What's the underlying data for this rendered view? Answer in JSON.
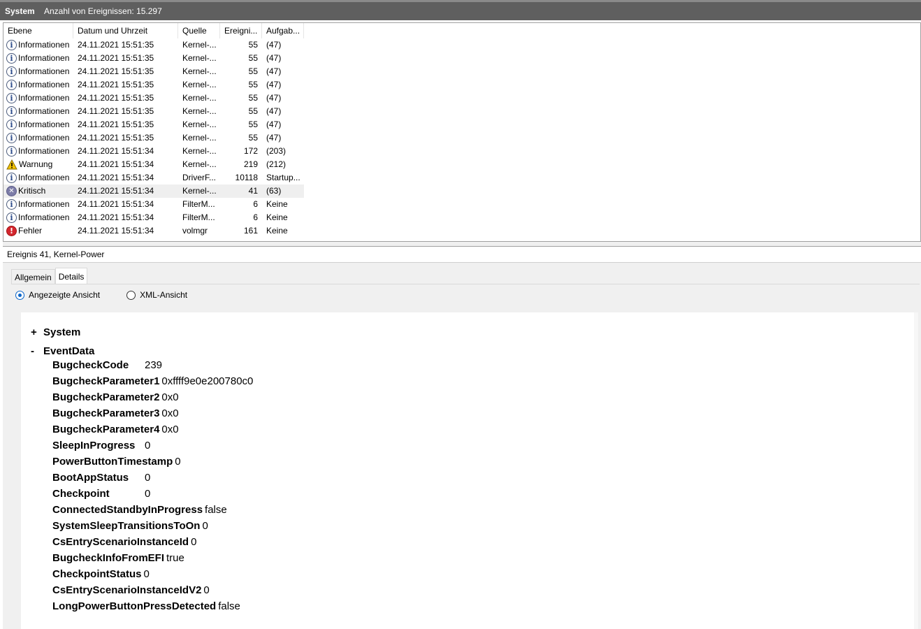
{
  "header": {
    "title": "System",
    "count": "Anzahl von Ereignissen: 15.297"
  },
  "columns": [
    "Ebene",
    "Datum und Uhrzeit",
    "Quelle",
    "Ereigni...",
    "Aufgab..."
  ],
  "rows": [
    {
      "level": "Informationen",
      "icon": "info-icon",
      "date": "24.11.2021 15:51:35",
      "source": "Kernel-...",
      "id": "55",
      "task": "(47)"
    },
    {
      "level": "Informationen",
      "icon": "info-icon",
      "date": "24.11.2021 15:51:35",
      "source": "Kernel-...",
      "id": "55",
      "task": "(47)"
    },
    {
      "level": "Informationen",
      "icon": "info-icon",
      "date": "24.11.2021 15:51:35",
      "source": "Kernel-...",
      "id": "55",
      "task": "(47)"
    },
    {
      "level": "Informationen",
      "icon": "info-icon",
      "date": "24.11.2021 15:51:35",
      "source": "Kernel-...",
      "id": "55",
      "task": "(47)"
    },
    {
      "level": "Informationen",
      "icon": "info-icon",
      "date": "24.11.2021 15:51:35",
      "source": "Kernel-...",
      "id": "55",
      "task": "(47)"
    },
    {
      "level": "Informationen",
      "icon": "info-icon",
      "date": "24.11.2021 15:51:35",
      "source": "Kernel-...",
      "id": "55",
      "task": "(47)"
    },
    {
      "level": "Informationen",
      "icon": "info-icon",
      "date": "24.11.2021 15:51:35",
      "source": "Kernel-...",
      "id": "55",
      "task": "(47)"
    },
    {
      "level": "Informationen",
      "icon": "info-icon",
      "date": "24.11.2021 15:51:35",
      "source": "Kernel-...",
      "id": "55",
      "task": "(47)"
    },
    {
      "level": "Informationen",
      "icon": "info-icon",
      "date": "24.11.2021 15:51:34",
      "source": "Kernel-...",
      "id": "172",
      "task": "(203)"
    },
    {
      "level": "Warnung",
      "icon": "warning-icon",
      "date": "24.11.2021 15:51:34",
      "source": "Kernel-...",
      "id": "219",
      "task": "(212)"
    },
    {
      "level": "Informationen",
      "icon": "info-icon",
      "date": "24.11.2021 15:51:34",
      "source": "DriverF...",
      "id": "10118",
      "task": "Startup..."
    },
    {
      "level": "Kritisch",
      "icon": "critical-icon",
      "date": "24.11.2021 15:51:34",
      "source": "Kernel-...",
      "id": "41",
      "task": "(63)",
      "selected": true
    },
    {
      "level": "Informationen",
      "icon": "info-icon",
      "date": "24.11.2021 15:51:34",
      "source": "FilterM...",
      "id": "6",
      "task": "Keine"
    },
    {
      "level": "Informationen",
      "icon": "info-icon",
      "date": "24.11.2021 15:51:34",
      "source": "FilterM...",
      "id": "6",
      "task": "Keine"
    },
    {
      "level": "Fehler",
      "icon": "error-icon",
      "date": "24.11.2021 15:51:34",
      "source": "volmgr",
      "id": "161",
      "task": "Keine"
    }
  ],
  "detail": {
    "title": "Ereignis 41, Kernel-Power",
    "tabs": [
      "Allgemein",
      "Details"
    ],
    "active_tab": "Details",
    "view_options": [
      "Angezeigte Ansicht",
      "XML-Ansicht"
    ],
    "selected_view": "Angezeigte Ansicht",
    "sections": [
      {
        "toggle": "+",
        "name": "System"
      },
      {
        "toggle": "-",
        "name": "EventData"
      }
    ],
    "fields": [
      {
        "key": "BugcheckCode",
        "value": "239"
      },
      {
        "key": "BugcheckParameter1",
        "value": "0xffff9e0e200780c0"
      },
      {
        "key": "BugcheckParameter2",
        "value": "0x0"
      },
      {
        "key": "BugcheckParameter3",
        "value": "0x0"
      },
      {
        "key": "BugcheckParameter4",
        "value": "0x0"
      },
      {
        "key": "SleepInProgress",
        "value": "0"
      },
      {
        "key": "PowerButtonTimestamp",
        "value": "0"
      },
      {
        "key": "BootAppStatus",
        "value": "0"
      },
      {
        "key": "Checkpoint",
        "value": "0"
      },
      {
        "key": "ConnectedStandbyInProgress",
        "value": "false"
      },
      {
        "key": "SystemSleepTransitionsToOn",
        "value": "0"
      },
      {
        "key": "CsEntryScenarioInstanceId",
        "value": "0"
      },
      {
        "key": "BugcheckInfoFromEFI",
        "value": "true"
      },
      {
        "key": "CheckpointStatus",
        "value": "0"
      },
      {
        "key": "CsEntryScenarioInstanceIdV2",
        "value": "0"
      },
      {
        "key": "LongPowerButtonPressDetected",
        "value": "false"
      }
    ]
  },
  "colors": {
    "header_bg": "#5f5f5f",
    "radio_accent": "#0a64c8",
    "error_red": "#d4262e",
    "warn_yellow": "#f2c200",
    "critical": "#7d7da8"
  }
}
